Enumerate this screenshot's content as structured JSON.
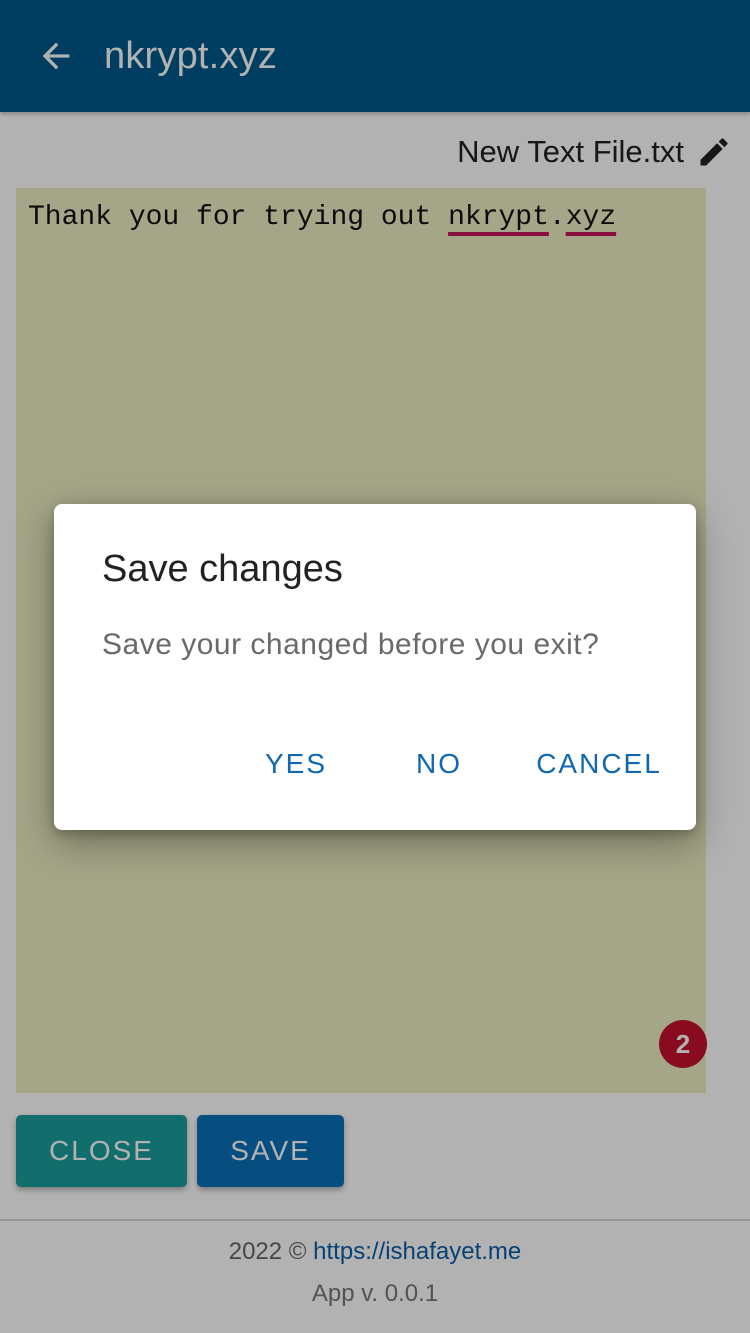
{
  "appbar": {
    "title": "nkrypt.xyz",
    "back_icon": "arrow-left-icon",
    "color": "#005a8c"
  },
  "file": {
    "name": "New Text File.txt",
    "edit_icon": "pencil-icon"
  },
  "editor": {
    "text_before": "Thank you for trying out ",
    "word1": "nkrypt",
    "dot": ".",
    "word2": "xyz",
    "background": "#ecedc2",
    "badge_count": "2"
  },
  "buttons": {
    "close_label": "CLOSE",
    "save_label": "SAVE"
  },
  "footer": {
    "copyright": "2022 © ",
    "link": "https://ishafayet.me",
    "version": "App v. 0.0.1"
  },
  "dialog": {
    "title": "Save changes",
    "message": "Save your changed before you exit?",
    "yes_label": "YES",
    "no_label": "NO",
    "cancel_label": "CANCEL"
  }
}
